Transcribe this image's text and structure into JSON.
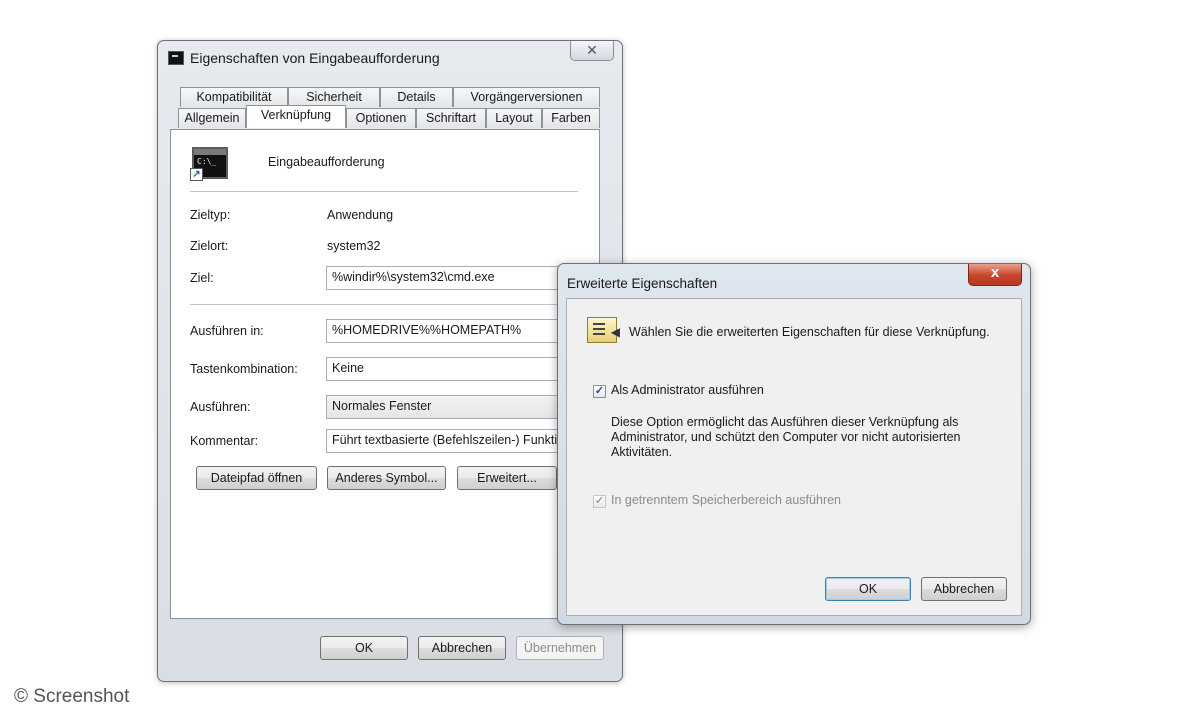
{
  "main_dialog": {
    "title": "Eigenschaften von Eingabeaufforderung",
    "tabs_row1": [
      "Kompatibilität",
      "Sicherheit",
      "Details",
      "Vorgängerversionen"
    ],
    "tabs_row2": [
      "Allgemein",
      "Verknüpfung",
      "Optionen",
      "Schriftart",
      "Layout",
      "Farben"
    ],
    "active_tab": "Verknüpfung",
    "shortcut_name": "Eingabeaufforderung",
    "icon_text": "C:\\_",
    "rows": {
      "zieltyp_label": "Zieltyp:",
      "zieltyp_value": "Anwendung",
      "zielort_label": "Zielort:",
      "zielort_value": "system32",
      "ziel_label": "Ziel:",
      "ziel_value": "%windir%\\system32\\cmd.exe",
      "ausfuehren_in_label": "Ausführen in:",
      "ausfuehren_in_value": "%HOMEDRIVE%%HOMEPATH%",
      "tasten_label": "Tastenkombination:",
      "tasten_value": "Keine",
      "ausfuehren_label": "Ausführen:",
      "ausfuehren_value": "Normales Fenster",
      "kommentar_label": "Kommentar:",
      "kommentar_value": "Führt textbasierte (Befehlszeilen-) Funktionen aus."
    },
    "buttons": {
      "open_path": "Dateipfad öffnen",
      "change_icon": "Anderes Symbol...",
      "advanced": "Erweitert...",
      "ok": "OK",
      "cancel": "Abbrechen",
      "apply": "Übernehmen"
    }
  },
  "advanced_dialog": {
    "title": "Erweiterte Eigenschaften",
    "close_glyph": "x",
    "intro": "Wählen Sie die erweiterten Eigenschaften für diese Verknüpfung.",
    "run_as_admin_label": "Als Administrator ausführen",
    "run_as_admin_checked": true,
    "description": "Diese Option ermöglicht das Ausführen dieser Verknüpfung als Administrator, und schützt den Computer vor nicht autorisierten Aktivitäten.",
    "separate_memory_label": "In getrenntem Speicherbereich ausführen",
    "separate_memory_checked": true,
    "separate_memory_enabled": false,
    "ok": "OK",
    "cancel": "Abbrechen"
  },
  "watermark": "© Screenshot"
}
